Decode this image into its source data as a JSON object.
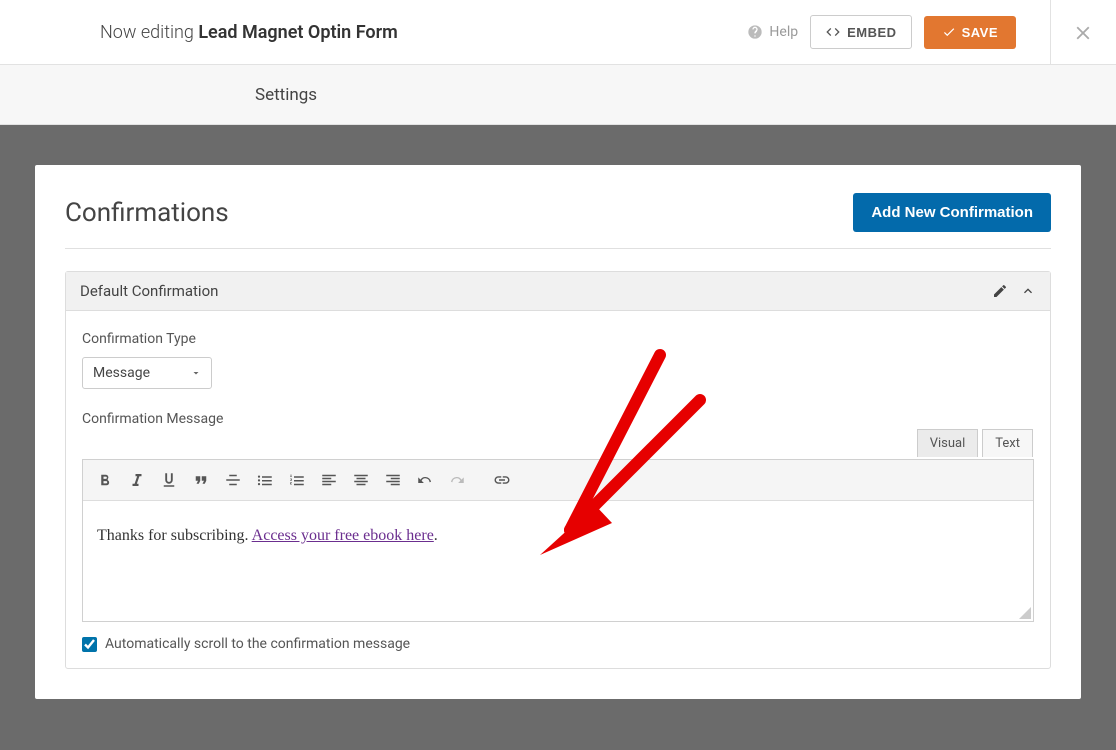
{
  "topbar": {
    "editing_prefix": "Now editing",
    "editing_title": "Lead Magnet Optin Form",
    "help_label": "Help",
    "embed_label": "EMBED",
    "save_label": "SAVE"
  },
  "tabs": {
    "settings_label": "Settings"
  },
  "panel": {
    "title": "Confirmations",
    "add_button": "Add New Confirmation"
  },
  "confirmation": {
    "header_title": "Default Confirmation",
    "type_label": "Confirmation Type",
    "type_value": "Message",
    "message_label": "Confirmation Message",
    "editor_tabs": {
      "visual": "Visual",
      "text": "Text"
    },
    "message_text": "Thanks for subscribing. ",
    "message_link": "Access your free ebook here",
    "message_suffix": ".",
    "autoscroll_label": "Automatically scroll to the confirmation message",
    "autoscroll_checked": true
  }
}
